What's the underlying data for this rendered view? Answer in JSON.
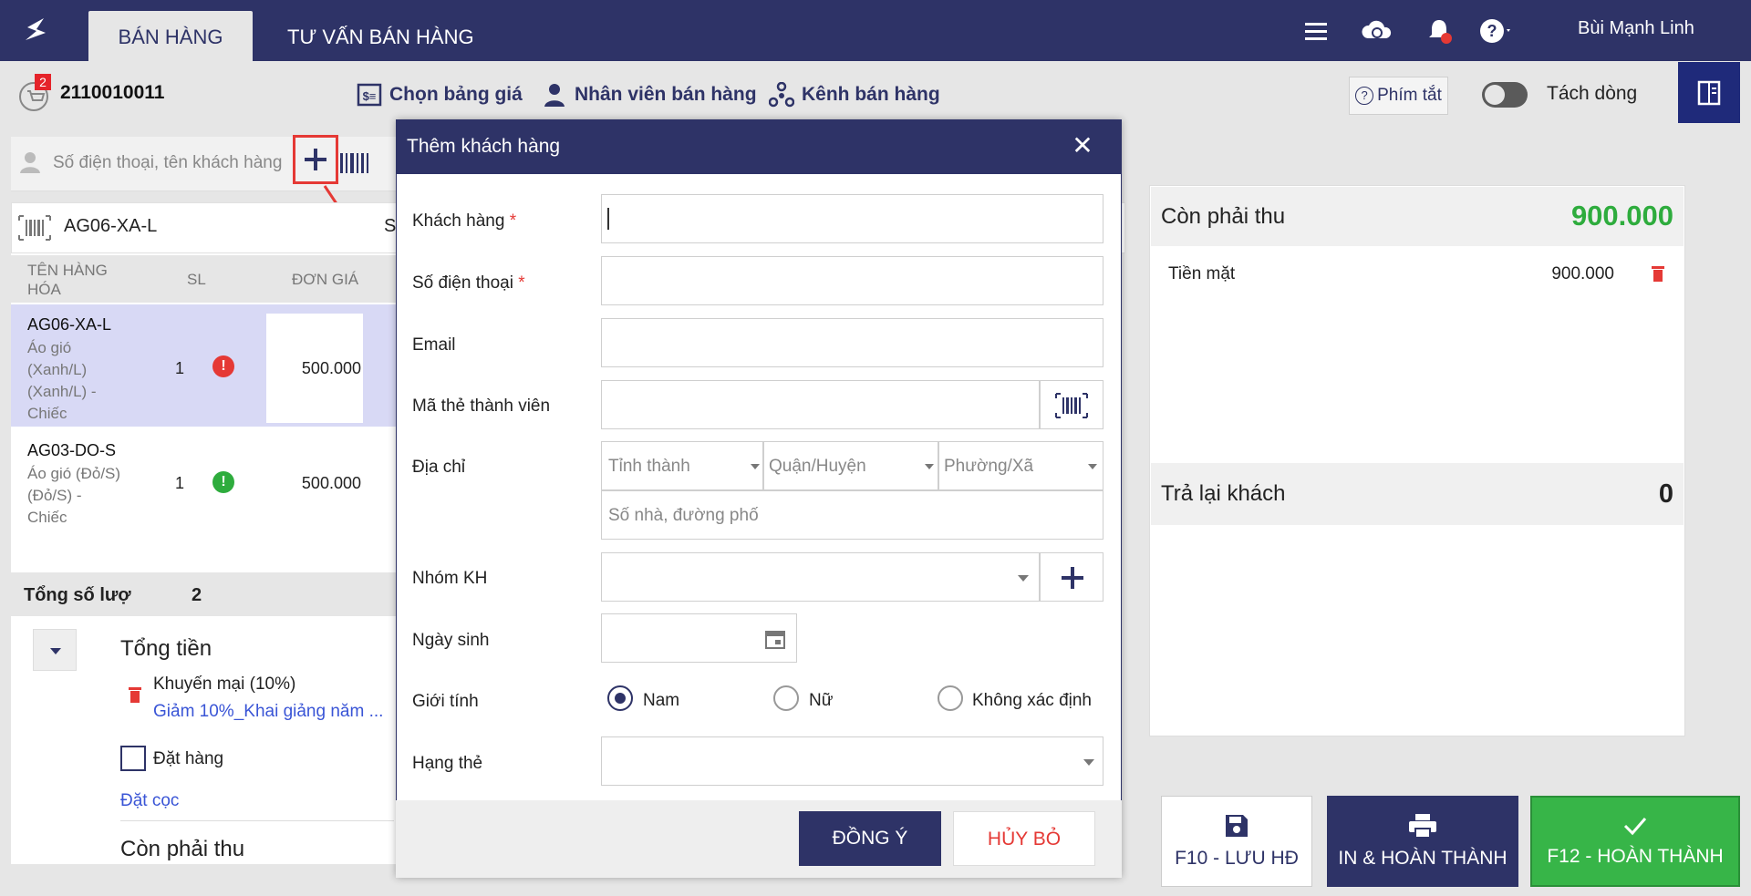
{
  "nav": {
    "tabs": [
      "BÁN HÀNG",
      "TƯ VẤN BÁN HÀNG"
    ],
    "user_name": "Bùi Mạnh Linh",
    "icons": [
      "menu-icon",
      "cloud-sync-icon",
      "bell-icon",
      "help-icon"
    ]
  },
  "toolbar": {
    "cart_badge": "2",
    "invoice_code": "2110010011",
    "price_list": "Chọn bảng giá",
    "sales_staff": "Nhân viên bán hàng",
    "sales_channel": "Kênh bán hàng",
    "shortcut": "Phím tắt",
    "split_line": "Tách dòng"
  },
  "customer_search": {
    "placeholder": "Số điện thoại, tên khách hàng"
  },
  "product_search": {
    "value": "AG06-XA-L",
    "cut_char": "S"
  },
  "cart": {
    "columns": [
      "TÊN HÀNG HÓA",
      "SL",
      "ĐƠN GIÁ"
    ],
    "rows": [
      {
        "code": "AG06-XA-L",
        "desc": [
          "Áo gió",
          "(Xanh/L)",
          "(Xanh/L) -",
          "Chiếc"
        ],
        "qty": "1",
        "status": "!",
        "price": "500.000"
      },
      {
        "code": "AG03-DO-S",
        "desc": [
          "Áo gió (Đỏ/S)",
          "(Đỏ/S) -",
          "Chiếc"
        ],
        "qty": "1",
        "status": "!",
        "price": "500.000"
      }
    ],
    "total_qty_label": "Tổng số lượ",
    "total_qty": "2",
    "total_money_label": "Tổng tiền",
    "promo_label": "Khuyến mại (10%)",
    "promo_link": "Giảm 10%_Khai giảng năm ...",
    "order_label": "Đặt hàng",
    "deposit_link": "Đặt cọc",
    "remaining_label": "Còn phải thu"
  },
  "payment": {
    "title": "Còn phải thu",
    "amount": "900.000",
    "cash_label": "Tiền mặt",
    "cash_value": "900.000",
    "return_title": "Trả lại khách",
    "return_amount": "0",
    "colors": {
      "amount": "#2eac3d",
      "trash": "#e53935"
    }
  },
  "actions": {
    "save": "F10 - LƯU HĐ",
    "print": "IN & HOÀN THÀNH",
    "finish": "F12 - HOÀN THÀNH"
  },
  "modal": {
    "title": "Thêm khách hàng",
    "fields": {
      "customer": "Khách hàng",
      "phone": "Số điện thoại",
      "email": "Email",
      "member_card": "Mã thẻ thành viên",
      "address": "Địa chỉ",
      "province": "Tỉnh thành",
      "district": "Quận/Huyện",
      "ward": "Phường/Xã",
      "street": "Số nhà, đường phố",
      "group": "Nhóm KH",
      "birthday": "Ngày sinh",
      "gender": "Giới tính",
      "gender_male": "Nam",
      "gender_female": "Nữ",
      "gender_unknown": "Không xác định",
      "card_rank": "Hạng thẻ"
    },
    "ok": "ĐỒNG Ý",
    "cancel": "HỦY BỎ"
  },
  "brand_colors": {
    "primary": "#2e3367",
    "success": "#37b548",
    "danger": "#e53935"
  }
}
